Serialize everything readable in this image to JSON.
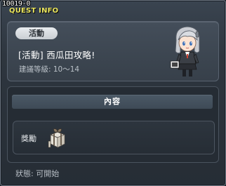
{
  "window": {
    "quest_id": "10019-0",
    "title": "QUEST INFO"
  },
  "header": {
    "category": "活動",
    "quest_name": "[活動] 西瓜田攻略!",
    "recommended_level": "建議等級: 10～14",
    "npc_icon": "npc-girl-silver-hair-icon"
  },
  "content": {
    "section_title": "內容",
    "reward_label": "獎勵",
    "reward_icon": "gift-box-icon"
  },
  "footer": {
    "status": "狀態: 可開始"
  },
  "colors": {
    "title_yellow": "#e9e45c",
    "panel_bg": "#37404a",
    "window_bg": "#2e363f"
  }
}
